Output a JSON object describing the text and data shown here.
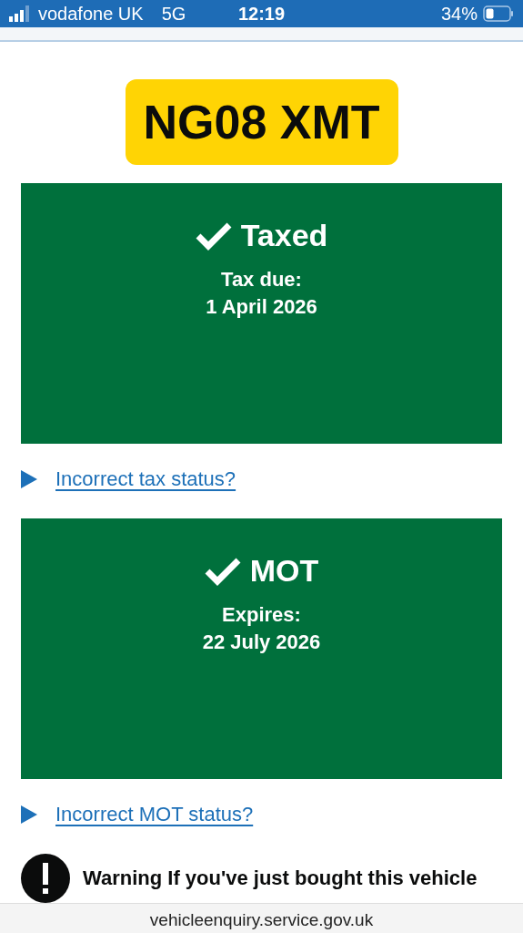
{
  "status_bar": {
    "carrier": "vodafone UK",
    "network": "5G",
    "time": "12:19",
    "battery": "34%"
  },
  "registration": "NG08 XMT",
  "statuses": [
    {
      "title": "Taxed",
      "ok": true,
      "label": "Tax due:",
      "date": "1 April 2026",
      "link": "Incorrect tax status?"
    },
    {
      "title": "MOT",
      "ok": true,
      "label": "Expires:",
      "date": "22 July 2026",
      "link": "Incorrect MOT status?"
    }
  ],
  "warning": "Warning If you've just bought this vehicle",
  "address_bar": {
    "url": "vehicleenquiry.service.gov.uk"
  }
}
